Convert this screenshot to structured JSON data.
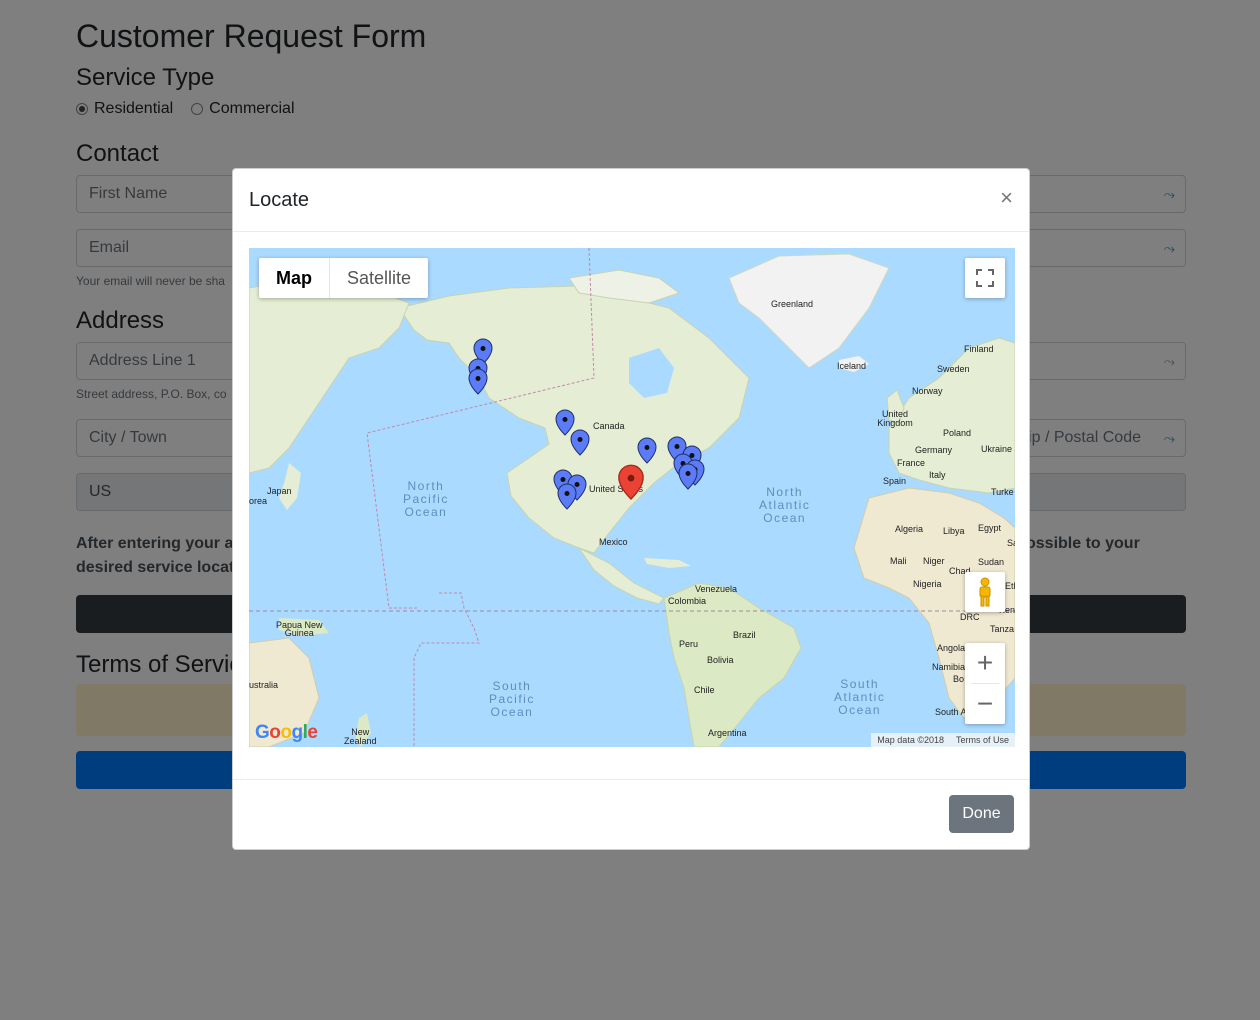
{
  "form": {
    "title": "Customer Request Form",
    "service_type": {
      "heading": "Service Type",
      "options": [
        "Residential",
        "Commercial"
      ],
      "selected": "Residential"
    },
    "contact": {
      "heading": "Contact",
      "first_name_placeholder": "First Name",
      "email_placeholder": "Email",
      "email_help": "Your email will never be sha"
    },
    "address": {
      "heading": "Address",
      "line1_placeholder": "Address Line 1",
      "line1_help": "Street address, P.O. Box, co",
      "city_placeholder": "City / Town",
      "zip_placeholder": "Zip / Postal Code",
      "country_value": "US"
    },
    "instructions_left": "After entering your a",
    "instructions_left_2": "desired service locati",
    "instructions_right": "ossible to your",
    "terms_heading": "Terms of Servic"
  },
  "modal": {
    "title": "Locate",
    "close_glyph": "×",
    "done_label": "Done"
  },
  "map": {
    "type_options": [
      "Map",
      "Satellite"
    ],
    "selected_type": "Map",
    "attribution_data": "Map data ©2018",
    "attribution_terms": "Terms of Use",
    "logo": "Google",
    "zoom_in": "+",
    "zoom_out": "−",
    "labels": {
      "greenland": "Greenland",
      "iceland": "Iceland",
      "finland": "Finland",
      "sweden": "Sweden",
      "norway": "Norway",
      "uk": "United Kingdom",
      "poland": "Poland",
      "germany": "Germany",
      "ukraine": "Ukraine",
      "france": "France",
      "italy": "Italy",
      "spain": "Spain",
      "turkey": "Turke",
      "canada": "Canada",
      "us": "United States",
      "mexico": "Mexico",
      "japan": "Japan",
      "korea": "orea",
      "venezuela": "Venezuela",
      "colombia": "Colombia",
      "peru": "Peru",
      "brazil": "Brazil",
      "bolivia": "Bolivia",
      "chile": "Chile",
      "argentina": "Argentina",
      "algeria": "Algeria",
      "libya": "Libya",
      "egypt": "Egypt",
      "mali": "Mali",
      "niger": "Niger",
      "chad": "Chad",
      "sudan": "Sudan",
      "nigeria": "Nigeria",
      "drc": "DRC",
      "tanzania": "Tanza",
      "angola": "Angola",
      "namibia": "Namibia",
      "botswana": "Bo",
      "south_africa": "South A",
      "png": "Papua New\nGuinea",
      "australia": "ustralia",
      "nz": "New\nZealand",
      "ethiopia": "Eth",
      "kenya": "Ken",
      "saudi": "Sa"
    },
    "oceans": {
      "north_pacific": "North\nPacific\nOcean",
      "north_atlantic": "North\nAtlantic\nOcean",
      "south_pacific": "South\nPacific\nOcean",
      "south_atlantic": "South\nAtlantic\nOcean"
    },
    "colors": {
      "water": "#aadaff",
      "land": "#e8f0d8",
      "marker_blue": "#5b7cf6",
      "marker_red": "#ea4335"
    }
  }
}
